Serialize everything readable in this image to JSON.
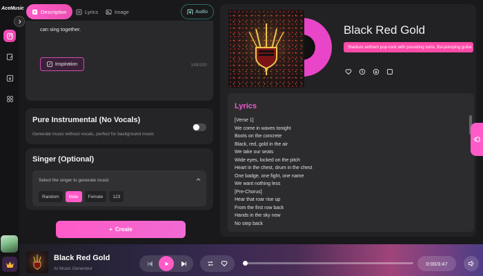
{
  "app": {
    "logo_text": "AceMusic"
  },
  "tabs": [
    {
      "label": "Description",
      "icon": "document-icon",
      "active": true
    },
    {
      "label": "Lyrics",
      "icon": "lyrics-icon",
      "active": false
    },
    {
      "label": "Image",
      "icon": "image-icon",
      "active": false
    }
  ],
  "audio_button": {
    "label": "Audio",
    "icon": "upload-audio-icon"
  },
  "description": {
    "text": "can sing together.",
    "inspiration_label": "Inspiration",
    "char_count": "149/200"
  },
  "instrumental": {
    "title": "Pure Instrumental (No Vocals)",
    "subtitle": "Generate music without vocals, perfect for background music",
    "enabled": false
  },
  "singer": {
    "title": "Singer (Optional)",
    "hint": "Select the singer to generate music",
    "options": [
      "Random",
      "Male",
      "Female",
      "123"
    ],
    "selected": "Male"
  },
  "create_button": {
    "label": "Create"
  },
  "song": {
    "title": "Black Red Gold",
    "style": "Stadium anthem pop-rock with pounding toms, fist-pumping guitar riffs and crowd chants"
  },
  "lyrics": {
    "title": "Lyrics",
    "lines": [
      "[Verse 1]",
      "We come in waves tonight",
      "Boots on the concrete",
      "Black, red, gold in the air",
      "We take our seats",
      "Wide eyes, locked on the pitch",
      "Heart in the chest, drum in the chest",
      "One badge, one fight, one name",
      "We want nothing less",
      "[Pre-Chorus]",
      "Hear that roar rise up",
      "From the first row back",
      "Hands in the sky now",
      "No step back"
    ]
  },
  "player": {
    "title": "Black Red Gold",
    "subtitle": "AI Music Generator",
    "time": "0:00/3:47",
    "progress": 0
  },
  "colors": {
    "accent": "#ff5bc8",
    "panel": "#252527",
    "bg": "#19191b"
  }
}
